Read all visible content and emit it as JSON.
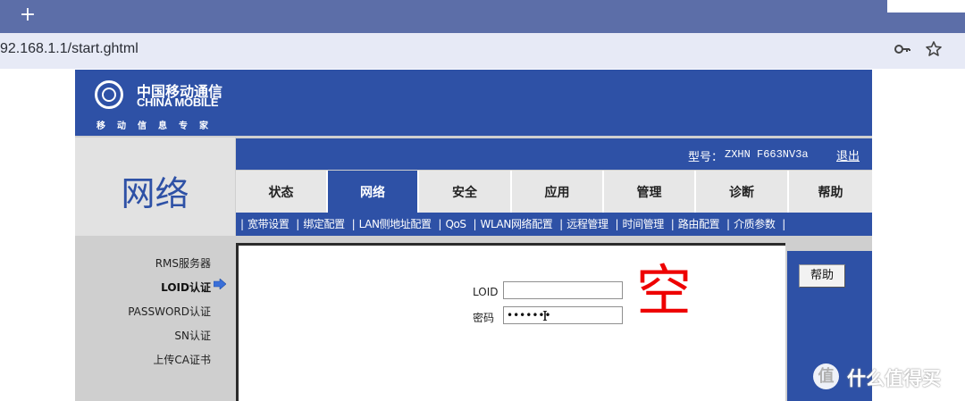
{
  "browser": {
    "new_tab": "+",
    "url": "92.168.1.1/start.ghtml",
    "icons": [
      "key-icon",
      "star-icon"
    ]
  },
  "brand": {
    "name_cn": "中国移动通信",
    "name_en": "CHINA MOBILE",
    "slogan": "移动信息专家"
  },
  "section_title": "网络",
  "model": {
    "label": "型号：",
    "value": "ZXHN F663NV3a",
    "logout": "退出"
  },
  "nav_tabs": [
    "状态",
    "网络",
    "安全",
    "应用",
    "管理",
    "诊断",
    "帮助"
  ],
  "active_tab": "网络",
  "subnav": [
    "宽带设置",
    "绑定配置",
    "LAN侧地址配置",
    "QoS",
    "WLAN网络配置",
    "远程管理",
    "时间管理",
    "路由配置",
    "介质参数"
  ],
  "sidebar": [
    "RMS服务器",
    "LOID认证",
    "PASSWORD认证",
    "SN认证",
    "上传CA证书"
  ],
  "active_sidebar": "LOID认证",
  "form": {
    "loid_label": "LOID",
    "loid_value": "",
    "password_label": "密码",
    "password_value": "•••••••"
  },
  "annotation": "空",
  "help_button": "帮助",
  "watermark": {
    "glyph": "值",
    "text": "什么值得买"
  },
  "colors": {
    "brand_blue": "#2e51a6",
    "annotation_red": "#ee0000",
    "browser_tabbar": "#5c6ea8"
  }
}
